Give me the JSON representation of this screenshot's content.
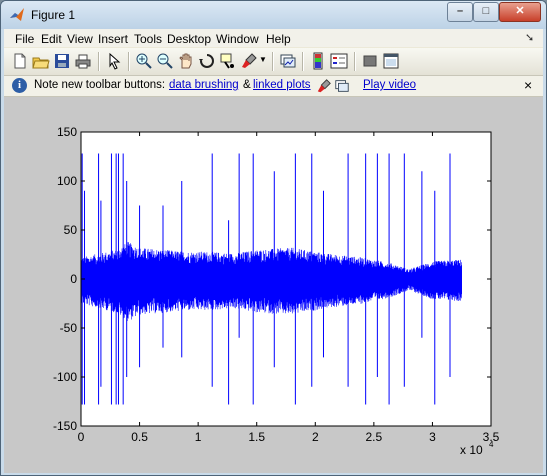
{
  "window": {
    "title": "Figure 1"
  },
  "menu": [
    "File",
    "Edit",
    "View",
    "Insert",
    "Tools",
    "Desktop",
    "Window",
    "Help"
  ],
  "toolbar": [
    "new-figure-icon",
    "open-file-icon",
    "save-icon",
    "print-icon",
    "select-arrow-icon",
    "zoom-in-icon",
    "zoom-out-icon",
    "pan-hand-icon",
    "rotate-3d-icon",
    "data-cursor-icon",
    "brush-icon",
    "link-plot-icon",
    "colorbar-icon",
    "legend-icon",
    "hide-plot-tools-icon",
    "show-plot-tools-icon"
  ],
  "infobar": {
    "prefix": "Note new toolbar buttons:",
    "link_brushing": "data brushing",
    "amp": "&",
    "link_linked": "linked plots",
    "link_video": "Play video",
    "close": "×"
  },
  "colors": {
    "series": "#0000ff",
    "plot_bg": "#ffffff",
    "figure_bg": "#c8c8c8"
  },
  "chart_data": {
    "type": "line",
    "title": "",
    "xlabel": "",
    "ylabel": "",
    "xlim": [
      0,
      35000
    ],
    "ylim": [
      -150,
      150
    ],
    "xticks": [
      0,
      0.5,
      1,
      1.5,
      2,
      2.5,
      3,
      3.5
    ],
    "xtick_labels": [
      "0",
      "0.5",
      "1",
      "1.5",
      "2",
      "2.5",
      "3",
      "3.5"
    ],
    "x_multiplier": "x 10",
    "x_multiplier_exp": "4",
    "yticks": [
      -150,
      -100,
      -50,
      0,
      50,
      100,
      150
    ],
    "ytick_labels": [
      "-150",
      "-100",
      "-50",
      "0",
      "50",
      "100",
      "150"
    ],
    "grid": false,
    "series": [
      {
        "values_summary": "dense noisy waveform; body amplitude about ±30, with clipping spikes to ±128",
        "x_range": [
          0,
          32500
        ],
        "envelope": [
          {
            "x": 0,
            "amp": 22
          },
          {
            "x": 3000,
            "amp": 30
          },
          {
            "x": 4000,
            "amp": 38
          },
          {
            "x": 5000,
            "amp": 32
          },
          {
            "x": 7000,
            "amp": 30
          },
          {
            "x": 9000,
            "amp": 28
          },
          {
            "x": 11000,
            "amp": 28
          },
          {
            "x": 13000,
            "amp": 26
          },
          {
            "x": 15000,
            "amp": 30
          },
          {
            "x": 18000,
            "amp": 32
          },
          {
            "x": 21000,
            "amp": 26
          },
          {
            "x": 24000,
            "amp": 22
          },
          {
            "x": 26500,
            "amp": 16
          },
          {
            "x": 28000,
            "amp": 10
          },
          {
            "x": 30000,
            "amp": 18
          },
          {
            "x": 32500,
            "amp": 20
          }
        ],
        "spikes": [
          {
            "x": 100,
            "lo": -128,
            "hi": 128
          },
          {
            "x": 300,
            "lo": -128,
            "hi": 90
          },
          {
            "x": 1500,
            "lo": -128,
            "hi": 128
          },
          {
            "x": 1700,
            "lo": -110,
            "hi": 80
          },
          {
            "x": 2600,
            "lo": -128,
            "hi": 128
          },
          {
            "x": 3000,
            "lo": -128,
            "hi": 128
          },
          {
            "x": 3200,
            "lo": -128,
            "hi": 128
          },
          {
            "x": 3600,
            "lo": -128,
            "hi": 128
          },
          {
            "x": 3900,
            "lo": -100,
            "hi": 100
          },
          {
            "x": 5000,
            "lo": -90,
            "hi": 75
          },
          {
            "x": 7000,
            "lo": -70,
            "hi": 75
          },
          {
            "x": 8600,
            "lo": -80,
            "hi": 100
          },
          {
            "x": 11200,
            "lo": -110,
            "hi": 128
          },
          {
            "x": 12600,
            "lo": -128,
            "hi": 60
          },
          {
            "x": 13500,
            "lo": -60,
            "hi": 128
          },
          {
            "x": 14700,
            "lo": -128,
            "hi": 128
          },
          {
            "x": 16500,
            "lo": -90,
            "hi": 110
          },
          {
            "x": 18300,
            "lo": -128,
            "hi": 128
          },
          {
            "x": 19700,
            "lo": -110,
            "hi": 128
          },
          {
            "x": 20700,
            "lo": -80,
            "hi": 90
          },
          {
            "x": 22800,
            "lo": -110,
            "hi": 128
          },
          {
            "x": 24300,
            "lo": -128,
            "hi": 128
          },
          {
            "x": 25300,
            "lo": -100,
            "hi": 128
          },
          {
            "x": 26300,
            "lo": -128,
            "hi": 128
          },
          {
            "x": 27600,
            "lo": -110,
            "hi": 128
          },
          {
            "x": 29100,
            "lo": -60,
            "hi": 110
          },
          {
            "x": 30200,
            "lo": -128,
            "hi": 90
          },
          {
            "x": 31500,
            "lo": -100,
            "hi": 128
          }
        ]
      }
    ]
  }
}
